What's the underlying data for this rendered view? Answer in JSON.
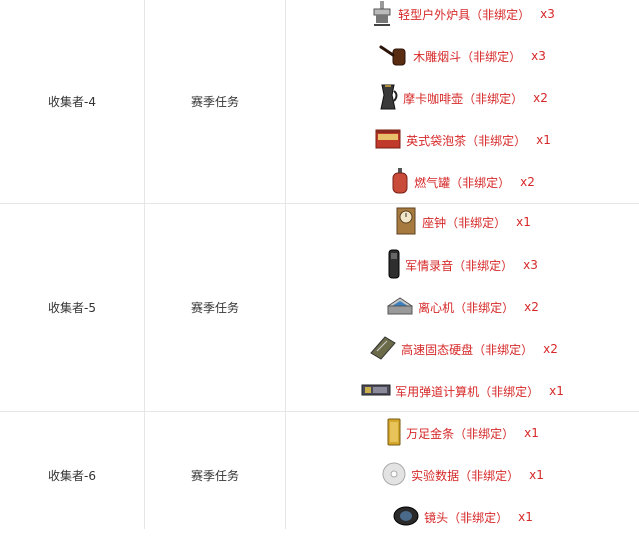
{
  "rows": [
    {
      "name": "收集者-4",
      "type": "赛季任务",
      "items": [
        {
          "label": "轻型户外炉具（非绑定）",
          "qty": "x3",
          "icon": "stove-icon"
        },
        {
          "label": "木雕烟斗（非绑定）",
          "qty": "x3",
          "icon": "pipe-icon"
        },
        {
          "label": "摩卡咖啡壶（非绑定）",
          "qty": "x2",
          "icon": "moka-pot-icon"
        },
        {
          "label": "英式袋泡茶（非绑定）",
          "qty": "x1",
          "icon": "tea-box-icon"
        },
        {
          "label": "燃气罐（非绑定）",
          "qty": "x2",
          "icon": "gas-canister-icon"
        }
      ]
    },
    {
      "name": "收集者-5",
      "type": "赛季任务",
      "items": [
        {
          "label": "座钟（非绑定）",
          "qty": "x1",
          "icon": "clock-icon"
        },
        {
          "label": "军情录音（非绑定）",
          "qty": "x3",
          "icon": "recorder-icon"
        },
        {
          "label": "离心机（非绑定）",
          "qty": "x2",
          "icon": "centrifuge-icon"
        },
        {
          "label": "高速固态硬盘（非绑定）",
          "qty": "x2",
          "icon": "ssd-icon"
        },
        {
          "label": "军用弹道计算机（非绑定）",
          "qty": "x1",
          "icon": "ballistic-computer-icon"
        }
      ]
    },
    {
      "name": "收集者-6",
      "type": "赛季任务",
      "items": [
        {
          "label": "万足金条（非绑定）",
          "qty": "x1",
          "icon": "gold-bar-icon"
        },
        {
          "label": "实验数据（非绑定）",
          "qty": "x1",
          "icon": "disc-icon"
        },
        {
          "label": "镜头（非绑定）",
          "qty": "x1",
          "icon": "lens-icon"
        }
      ]
    }
  ]
}
